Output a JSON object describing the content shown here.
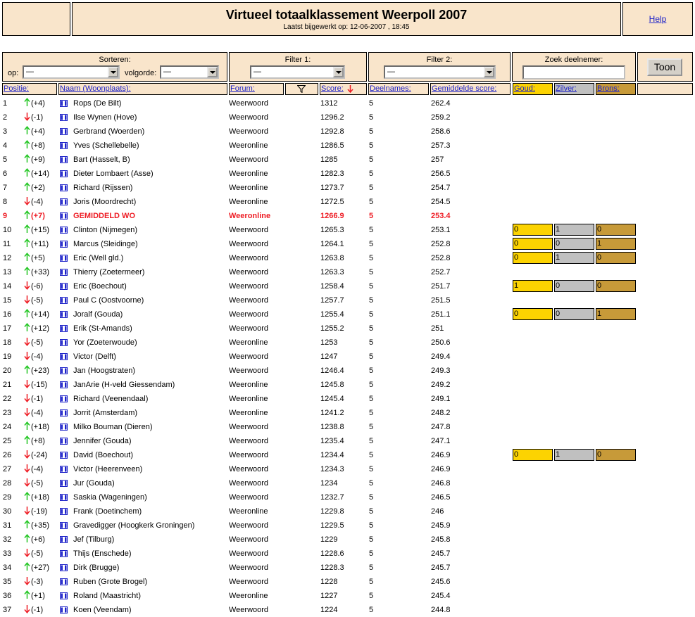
{
  "header": {
    "title": "Virtueel totaalklassement Weerpoll 2007",
    "subtitle": "Laatst bijgewerkt op: 12-06-2007 , 18:45",
    "help_label": "Help"
  },
  "controls": {
    "sort_label": "Sorteren:",
    "op_label": "op:",
    "volgorde_label": "volgorde:",
    "sort_op_value": "—",
    "sort_order_value": "—",
    "filter1_label": "Filter 1:",
    "filter1_value": "—",
    "filter2_label": "Filter 2:",
    "filter2_value": "—",
    "search_label": "Zoek deelnemer:",
    "search_value": "",
    "show_button": "Toon"
  },
  "columns": {
    "positie": "Positie:",
    "naam": "Naam (Woonplaats):",
    "forum": "Forum:",
    "score": "Score:",
    "deelnames": "Deelnames:",
    "gemiddelde": "Gemiddelde score:",
    "goud": "Goud:",
    "zilver": "Zilver:",
    "brons": "Brons:"
  },
  "colors": {
    "panel_bg": "#f9e5cb",
    "link": "#1c21c8",
    "up": "#22c622",
    "down": "#ee1c24",
    "highlight": "#ee1c24",
    "gold": "#fcd301",
    "silver": "#c0c0c0",
    "bronze": "#c79a39"
  },
  "icons": {
    "filter": "funnel-icon",
    "sort": "arrow-down-icon",
    "up": "arrow-up-icon",
    "down": "arrow-down-icon",
    "profile": "profile-icon"
  },
  "rows": [
    {
      "pos": "1",
      "dir": "up",
      "change": "(+4)",
      "naam": "Rops (De Bilt)",
      "forum": "Weerwoord",
      "score": "1312",
      "deel": "5",
      "gem": "262.4"
    },
    {
      "pos": "2",
      "dir": "down",
      "change": "(-1)",
      "naam": "Ilse Wynen (Hove)",
      "forum": "Weerwoord",
      "score": "1296.2",
      "deel": "5",
      "gem": "259.2"
    },
    {
      "pos": "3",
      "dir": "up",
      "change": "(+4)",
      "naam": "Gerbrand (Woerden)",
      "forum": "Weerwoord",
      "score": "1292.8",
      "deel": "5",
      "gem": "258.6"
    },
    {
      "pos": "4",
      "dir": "up",
      "change": "(+8)",
      "naam": "Yves (Schellebelle)",
      "forum": "Weeronline",
      "score": "1286.5",
      "deel": "5",
      "gem": "257.3"
    },
    {
      "pos": "5",
      "dir": "up",
      "change": "(+9)",
      "naam": "Bart (Hasselt, B)",
      "forum": "Weerwoord",
      "score": "1285",
      "deel": "5",
      "gem": "257"
    },
    {
      "pos": "6",
      "dir": "up",
      "change": "(+14)",
      "naam": "Dieter Lombaert (Asse)",
      "forum": "Weeronline",
      "score": "1282.3",
      "deel": "5",
      "gem": "256.5"
    },
    {
      "pos": "7",
      "dir": "up",
      "change": "(+2)",
      "naam": "Richard (Rijssen)",
      "forum": "Weeronline",
      "score": "1273.7",
      "deel": "5",
      "gem": "254.7"
    },
    {
      "pos": "8",
      "dir": "down",
      "change": "(-4)",
      "naam": "Joris (Moordrecht)",
      "forum": "Weeronline",
      "score": "1272.5",
      "deel": "5",
      "gem": "254.5"
    },
    {
      "pos": "9",
      "dir": "up",
      "change": "(+7)",
      "naam": "GEMIDDELD WO",
      "forum": "Weeronline",
      "score": "1266.9",
      "deel": "5",
      "gem": "253.4",
      "highlight": true
    },
    {
      "pos": "10",
      "dir": "up",
      "change": "(+15)",
      "naam": "Clinton (Nijmegen)",
      "forum": "Weerwoord",
      "score": "1265.3",
      "deel": "5",
      "gem": "253.1",
      "goud": "0",
      "zilver": "1",
      "brons": "0"
    },
    {
      "pos": "11",
      "dir": "up",
      "change": "(+11)",
      "naam": "Marcus (Sleidinge)",
      "forum": "Weerwoord",
      "score": "1264.1",
      "deel": "5",
      "gem": "252.8",
      "goud": "0",
      "zilver": "0",
      "brons": "1"
    },
    {
      "pos": "12",
      "dir": "up",
      "change": "(+5)",
      "naam": "Eric (Well gld.)",
      "forum": "Weerwoord",
      "score": "1263.8",
      "deel": "5",
      "gem": "252.8",
      "goud": "0",
      "zilver": "1",
      "brons": "0"
    },
    {
      "pos": "13",
      "dir": "up",
      "change": "(+33)",
      "naam": "Thierry (Zoetermeer)",
      "forum": "Weerwoord",
      "score": "1263.3",
      "deel": "5",
      "gem": "252.7"
    },
    {
      "pos": "14",
      "dir": "down",
      "change": "(-6)",
      "naam": "Eric (Boechout)",
      "forum": "Weerwoord",
      "score": "1258.4",
      "deel": "5",
      "gem": "251.7",
      "goud": "1",
      "zilver": "0",
      "brons": "0"
    },
    {
      "pos": "15",
      "dir": "down",
      "change": "(-5)",
      "naam": "Paul C (Oostvoorne)",
      "forum": "Weerwoord",
      "score": "1257.7",
      "deel": "5",
      "gem": "251.5"
    },
    {
      "pos": "16",
      "dir": "up",
      "change": "(+14)",
      "naam": "Joralf (Gouda)",
      "forum": "Weerwoord",
      "score": "1255.4",
      "deel": "5",
      "gem": "251.1",
      "goud": "0",
      "zilver": "0",
      "brons": "1"
    },
    {
      "pos": "17",
      "dir": "up",
      "change": "(+12)",
      "naam": "Erik (St-Amands)",
      "forum": "Weerwoord",
      "score": "1255.2",
      "deel": "5",
      "gem": "251"
    },
    {
      "pos": "18",
      "dir": "down",
      "change": "(-5)",
      "naam": "Yor (Zoeterwoude)",
      "forum": "Weeronline",
      "score": "1253",
      "deel": "5",
      "gem": "250.6"
    },
    {
      "pos": "19",
      "dir": "down",
      "change": "(-4)",
      "naam": "Victor (Delft)",
      "forum": "Weerwoord",
      "score": "1247",
      "deel": "5",
      "gem": "249.4"
    },
    {
      "pos": "20",
      "dir": "up",
      "change": "(+23)",
      "naam": "Jan (Hoogstraten)",
      "forum": "Weerwoord",
      "score": "1246.4",
      "deel": "5",
      "gem": "249.3"
    },
    {
      "pos": "21",
      "dir": "down",
      "change": "(-15)",
      "naam": "JanArie (H-veld Giessendam)",
      "forum": "Weeronline",
      "score": "1245.8",
      "deel": "5",
      "gem": "249.2"
    },
    {
      "pos": "22",
      "dir": "down",
      "change": "(-1)",
      "naam": "Richard (Veenendaal)",
      "forum": "Weeronline",
      "score": "1245.4",
      "deel": "5",
      "gem": "249.1"
    },
    {
      "pos": "23",
      "dir": "down",
      "change": "(-4)",
      "naam": "Jorrit (Amsterdam)",
      "forum": "Weeronline",
      "score": "1241.2",
      "deel": "5",
      "gem": "248.2"
    },
    {
      "pos": "24",
      "dir": "up",
      "change": "(+18)",
      "naam": "Milko Bouman (Dieren)",
      "forum": "Weerwoord",
      "score": "1238.8",
      "deel": "5",
      "gem": "247.8"
    },
    {
      "pos": "25",
      "dir": "up",
      "change": "(+8)",
      "naam": "Jennifer (Gouda)",
      "forum": "Weerwoord",
      "score": "1235.4",
      "deel": "5",
      "gem": "247.1"
    },
    {
      "pos": "26",
      "dir": "down",
      "change": "(-24)",
      "naam": "David (Boechout)",
      "forum": "Weerwoord",
      "score": "1234.4",
      "deel": "5",
      "gem": "246.9",
      "goud": "0",
      "zilver": "1",
      "brons": "0"
    },
    {
      "pos": "27",
      "dir": "down",
      "change": "(-4)",
      "naam": "Victor (Heerenveen)",
      "forum": "Weerwoord",
      "score": "1234.3",
      "deel": "5",
      "gem": "246.9"
    },
    {
      "pos": "28",
      "dir": "down",
      "change": "(-5)",
      "naam": "Jur (Gouda)",
      "forum": "Weerwoord",
      "score": "1234",
      "deel": "5",
      "gem": "246.8"
    },
    {
      "pos": "29",
      "dir": "up",
      "change": "(+18)",
      "naam": "Saskia (Wageningen)",
      "forum": "Weerwoord",
      "score": "1232.7",
      "deel": "5",
      "gem": "246.5"
    },
    {
      "pos": "30",
      "dir": "down",
      "change": "(-19)",
      "naam": "Frank (Doetinchem)",
      "forum": "Weeronline",
      "score": "1229.8",
      "deel": "5",
      "gem": "246"
    },
    {
      "pos": "31",
      "dir": "up",
      "change": "(+35)",
      "naam": "Gravedigger (Hoogkerk Groningen)",
      "forum": "Weerwoord",
      "score": "1229.5",
      "deel": "5",
      "gem": "245.9"
    },
    {
      "pos": "32",
      "dir": "up",
      "change": "(+6)",
      "naam": "Jef (Tilburg)",
      "forum": "Weerwoord",
      "score": "1229",
      "deel": "5",
      "gem": "245.8"
    },
    {
      "pos": "33",
      "dir": "down",
      "change": "(-5)",
      "naam": "Thijs (Enschede)",
      "forum": "Weerwoord",
      "score": "1228.6",
      "deel": "5",
      "gem": "245.7"
    },
    {
      "pos": "34",
      "dir": "up",
      "change": "(+27)",
      "naam": "Dirk (Brugge)",
      "forum": "Weerwoord",
      "score": "1228.3",
      "deel": "5",
      "gem": "245.7"
    },
    {
      "pos": "35",
      "dir": "down",
      "change": "(-3)",
      "naam": "Ruben (Grote Brogel)",
      "forum": "Weerwoord",
      "score": "1228",
      "deel": "5",
      "gem": "245.6"
    },
    {
      "pos": "36",
      "dir": "up",
      "change": "(+1)",
      "naam": "Roland (Maastricht)",
      "forum": "Weeronline",
      "score": "1227",
      "deel": "5",
      "gem": "245.4"
    },
    {
      "pos": "37",
      "dir": "down",
      "change": "(-1)",
      "naam": "Koen (Veendam)",
      "forum": "Weerwoord",
      "score": "1224",
      "deel": "5",
      "gem": "244.8"
    }
  ]
}
